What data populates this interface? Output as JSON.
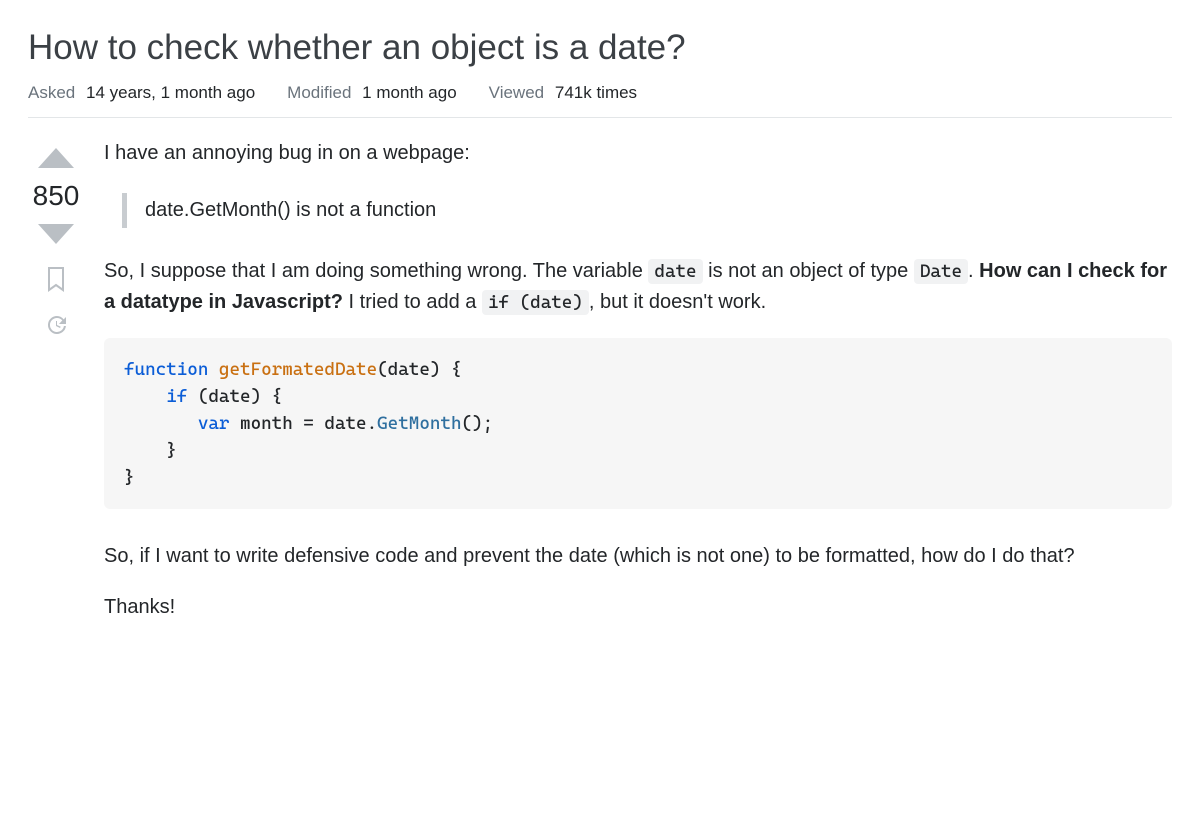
{
  "question": {
    "title": "How to check whether an object is a date?",
    "meta": {
      "asked_label": "Asked",
      "asked_value": "14 years, 1 month ago",
      "modified_label": "Modified",
      "modified_value": "1 month ago",
      "viewed_label": "Viewed",
      "viewed_value": "741k times"
    },
    "votes": "850"
  },
  "body": {
    "p1": "I have an annoying bug in on a webpage:",
    "quote": "date.GetMonth() is not a function",
    "p2a": "So, I suppose that I am doing something wrong. The variable ",
    "code_date": "date",
    "p2b": " is not an object of type ",
    "code_Date": "Date",
    "p2c": ". ",
    "p2_strong": "How can I check for a datatype in Javascript?",
    "p2d": " I tried to add a ",
    "code_ifdate": "if (date)",
    "p2e": ", but it doesn't work.",
    "p3": "So, if I want to write defensive code and prevent the date (which is not one) to be formatted, how do I do that?",
    "p4": "Thanks!"
  },
  "code": {
    "kw_function": "function",
    "fn_name": "getFormatedDate",
    "paren_date": "(date) {",
    "kw_if": "if",
    "if_cond": " (date) {",
    "kw_var": "var",
    "assign": " month = date.",
    "method": "GetMonth",
    "after_method": "();",
    "close1": "}",
    "close2": "}"
  }
}
